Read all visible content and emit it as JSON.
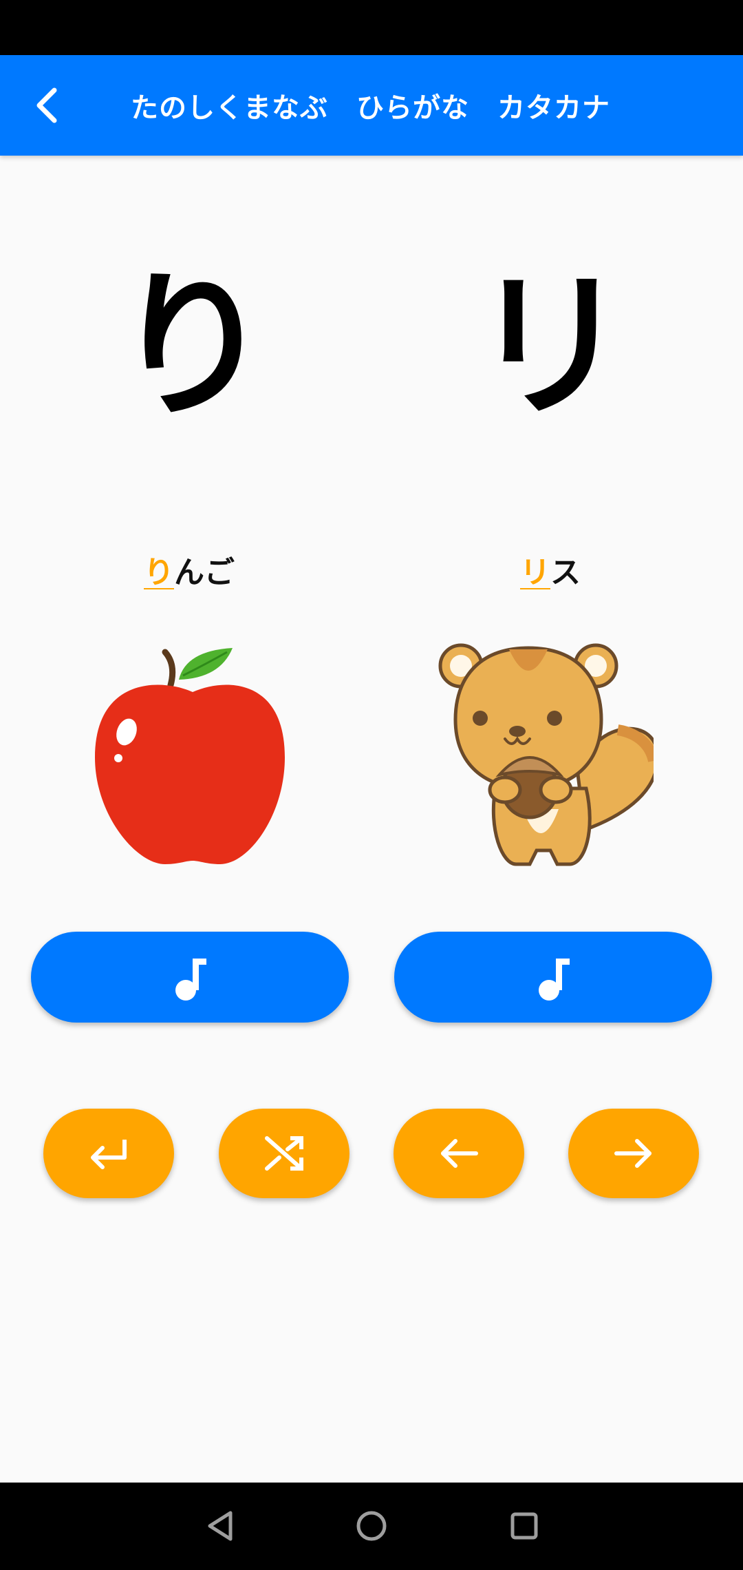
{
  "app_bar": {
    "title": "たのしくまなぶ　ひらがな　カタカナ",
    "back_icon": "chevron-left-icon",
    "background": "#0079ff"
  },
  "kana": {
    "hiragana": "り",
    "katakana": "リ"
  },
  "words": {
    "left": {
      "highlight": "り",
      "rest": "んご"
    },
    "right": {
      "highlight": "リ",
      "rest": "ス"
    }
  },
  "illustrations": {
    "left": "apple-illustration",
    "right": "squirrel-illustration"
  },
  "sound_buttons": {
    "icon": "music-note-icon",
    "color": "#0079ff"
  },
  "controls": {
    "color": "#ffa500",
    "buttons": [
      {
        "icon": "return-icon"
      },
      {
        "icon": "shuffle-icon"
      },
      {
        "icon": "arrow-left-icon"
      },
      {
        "icon": "arrow-right-icon"
      }
    ]
  },
  "system_nav": {
    "keys": [
      "back-triangle-icon",
      "home-circle-icon",
      "recents-square-icon"
    ]
  }
}
